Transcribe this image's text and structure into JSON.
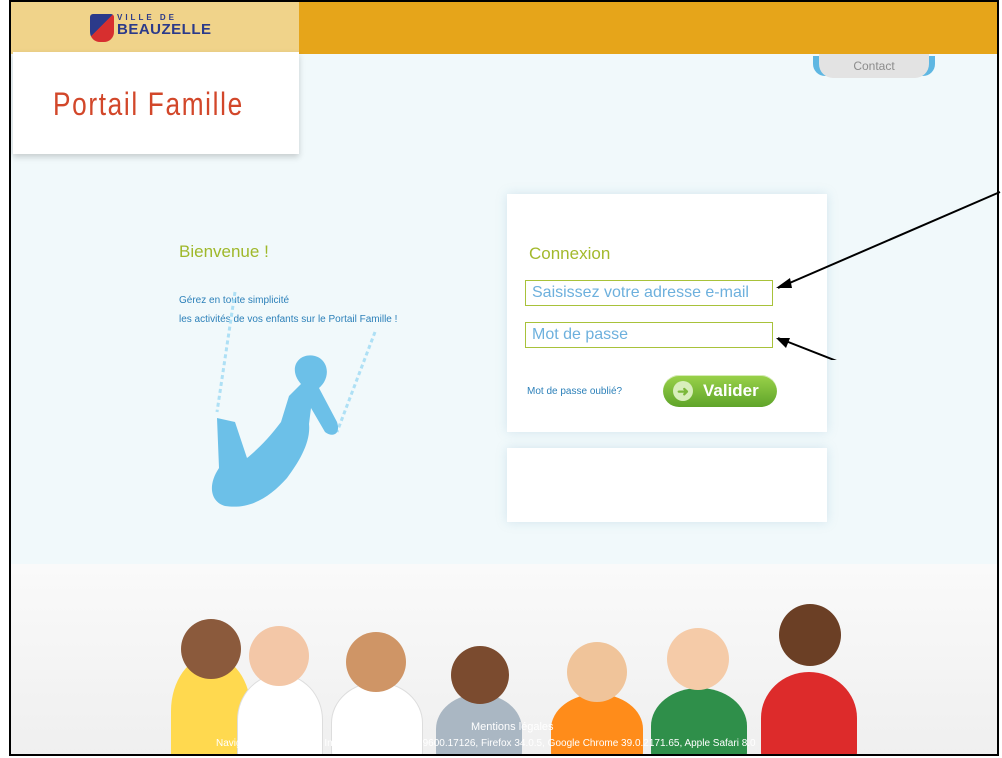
{
  "header": {
    "logo_top": "VILLE DE",
    "logo_name": "BEAUZELLE",
    "title": "Portail Famille",
    "contact_label": "Contact"
  },
  "welcome": {
    "title": "Bienvenue !",
    "line1": "Gérez en toute simplicité",
    "line2": "les activités de vos enfants sur le Portail Famille !"
  },
  "login": {
    "title": "Connexion",
    "email_placeholder": "Saisissez votre adresse e-mail",
    "password_placeholder": "Mot de passe",
    "forgot_label": "Mot de passe oublié?",
    "submit_label": "Valider"
  },
  "footer": {
    "legal": "Mentions légales",
    "browsers": "Navigateurs supportés : Internet Explorer 11.0.9600.17126, Firefox 34.0.5, Google Chrome 39.0.2171.65, Apple Safari 8.0"
  },
  "colors": {
    "topbar": "#e6a51a",
    "title": "#d2472a",
    "accent_green": "#a3b92c",
    "link_blue": "#2c80b9"
  },
  "icons": {
    "logo": "beauzelle-shield-icon",
    "submit": "arrow-right-icon"
  }
}
